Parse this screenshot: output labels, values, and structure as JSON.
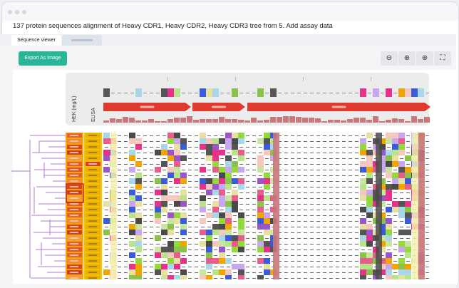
{
  "window": {
    "title": "137 protein sequences alignment of Heavy CDR1, Heavy CDR2, Heavy CDR3 tree from 5. Add assay data"
  },
  "tabs": [
    {
      "label": "Sequence viewer",
      "active": true
    },
    {
      "label": "",
      "active": false
    }
  ],
  "toolbar": {
    "export_label": "Export As Image",
    "zoom_icons": [
      "zoom-out-icon",
      "zoom-in-icon",
      "zoom-reset-icon",
      "fullscreen-icon"
    ],
    "zoom_glyphs": [
      "⊖",
      "⊕",
      "⊕",
      "⛶"
    ]
  },
  "columns": {
    "assay1": "HEK (mg/L)",
    "assay2": "ELISA"
  },
  "colors": {
    "accent": "#2bb597",
    "tree": "#b679d6",
    "annotation": "#e03a2f",
    "assay_hek": "#f0a500",
    "assay_elisa": "#f2c400"
  }
}
